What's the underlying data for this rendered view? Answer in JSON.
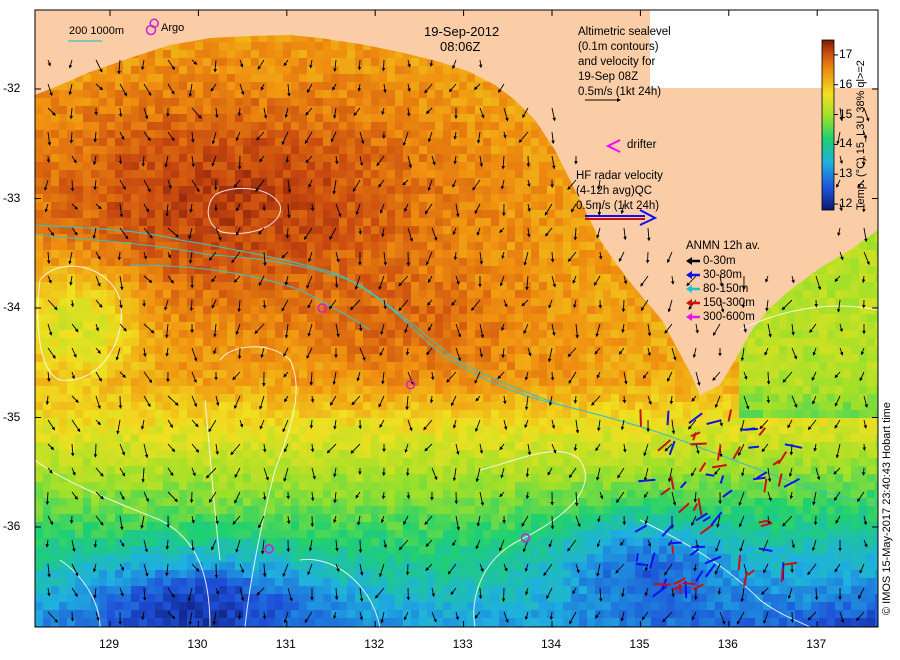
{
  "map": {
    "title_date": "19-Sep-2012",
    "title_time": "08:06Z",
    "scale_label": "200  1000m",
    "argo_label": "Argo",
    "altimetry_lines": [
      "Altimetric sealevel",
      "(0.1m contours)",
      "and velocity for",
      "19-Sep 08Z",
      "0.5m/s (1kt 24h)"
    ],
    "drifter_label": "drifter",
    "hf_lines": [
      "HF radar velocity",
      "(4-12h avg)QC",
      "0.5m/s (1kt 24h)"
    ],
    "anmn": {
      "title": "ANMN 12h av.",
      "items": [
        {
          "label": "0-30m",
          "color": "#000000"
        },
        {
          "label": "30-80m",
          "color": "#1010ee"
        },
        {
          "label": "80-150m",
          "color": "#20c0d0"
        },
        {
          "label": "150-300m",
          "color": "#cc1010"
        },
        {
          "label": "300-600m",
          "color": "#ee10ee"
        }
      ]
    },
    "colorbar": {
      "ticks": [
        "17",
        "16",
        "15",
        "14",
        "13",
        "12"
      ],
      "label": "Temp. (°C) 15_L3U 38% ql>=2",
      "min": 11.8,
      "max": 17.5
    },
    "y_ticks": [
      "-32",
      "-33",
      "-34",
      "-35",
      "-36"
    ],
    "x_ticks": [
      "129",
      "130",
      "131",
      "132",
      "133",
      "134",
      "135",
      "136",
      "137"
    ],
    "credit": "© IMOS 15-May-2017 23:40:43 Hobart time",
    "argo_floats": [
      {
        "lon": 131.4,
        "lat": -34.0
      },
      {
        "lon": 132.4,
        "lat": -34.7
      },
      {
        "lon": 130.8,
        "lat": -36.2
      },
      {
        "lon": 133.7,
        "lat": -36.1
      },
      {
        "lon": 129.5,
        "lat": -31.4
      }
    ],
    "colors": {
      "land": "#fbcda6",
      "argo": "#d020d0",
      "contour": "#ffffff",
      "isobath": "#40c0c0",
      "drifter": "#ff00ff"
    }
  }
}
